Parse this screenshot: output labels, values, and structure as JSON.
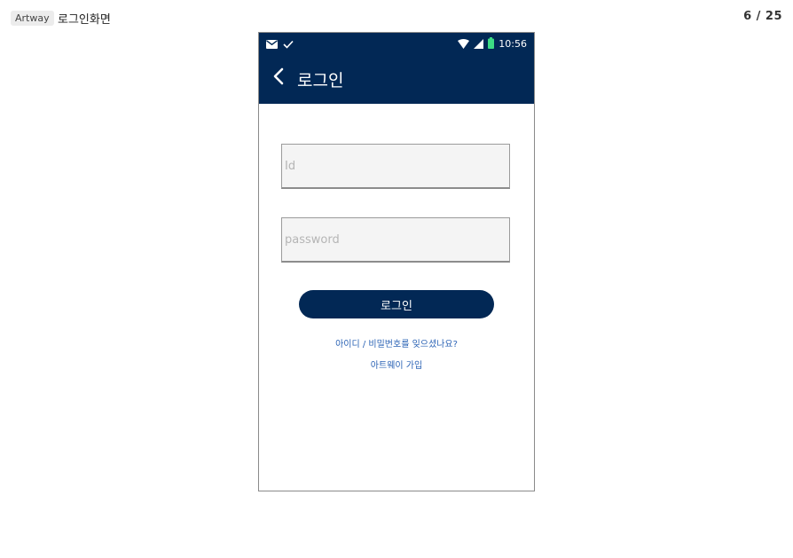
{
  "header": {
    "project_tag": "Artway",
    "screen_title": "로그인화면",
    "page_counter": "6 / 25"
  },
  "status_bar": {
    "left_icons": [
      "mail-icon",
      "check-icon"
    ],
    "right_icons": [
      "wifi-icon",
      "signal-icon",
      "battery-icon"
    ],
    "time": "10:56",
    "battery_color": "#3ddc84"
  },
  "app_bar": {
    "title": "로그인",
    "background_color": "#022855"
  },
  "form": {
    "id_placeholder": "Id",
    "password_placeholder": "password",
    "login_label": "로그인"
  },
  "links": {
    "forgot": "아이디 / 비밀번호를 잊으셨나요?",
    "join": "아트웨이 가입"
  }
}
